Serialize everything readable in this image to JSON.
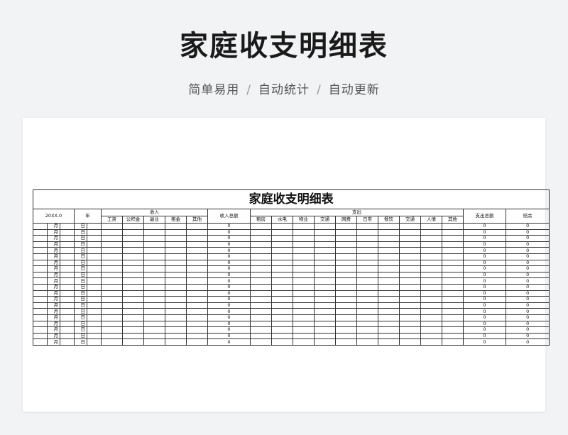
{
  "header": {
    "title": "家庭收支明细表",
    "features": [
      "简单易用",
      "自动统计",
      "自动更新"
    ],
    "separator": "/"
  },
  "sheet": {
    "title": "家庭收支明细表",
    "year_label": "20XX.0",
    "year_suffix": "年",
    "income_group": "收入",
    "income_total": "收入总额",
    "expense_group": "支出",
    "expense_total": "支出总额",
    "balance": "结余",
    "income_columns": [
      "工资",
      "公积金",
      "副业",
      "租金",
      "其他"
    ],
    "expense_columns": [
      "租房",
      "水电",
      "物业",
      "交通",
      "网费",
      "日常",
      "餐饮",
      "交通",
      "人情",
      "其他"
    ],
    "month_label": "月",
    "day_label": "日",
    "zero": "0",
    "row_count": 20
  },
  "colors": {
    "background": "#f2f3f5",
    "card": "#ffffff",
    "grid": "#333333"
  }
}
